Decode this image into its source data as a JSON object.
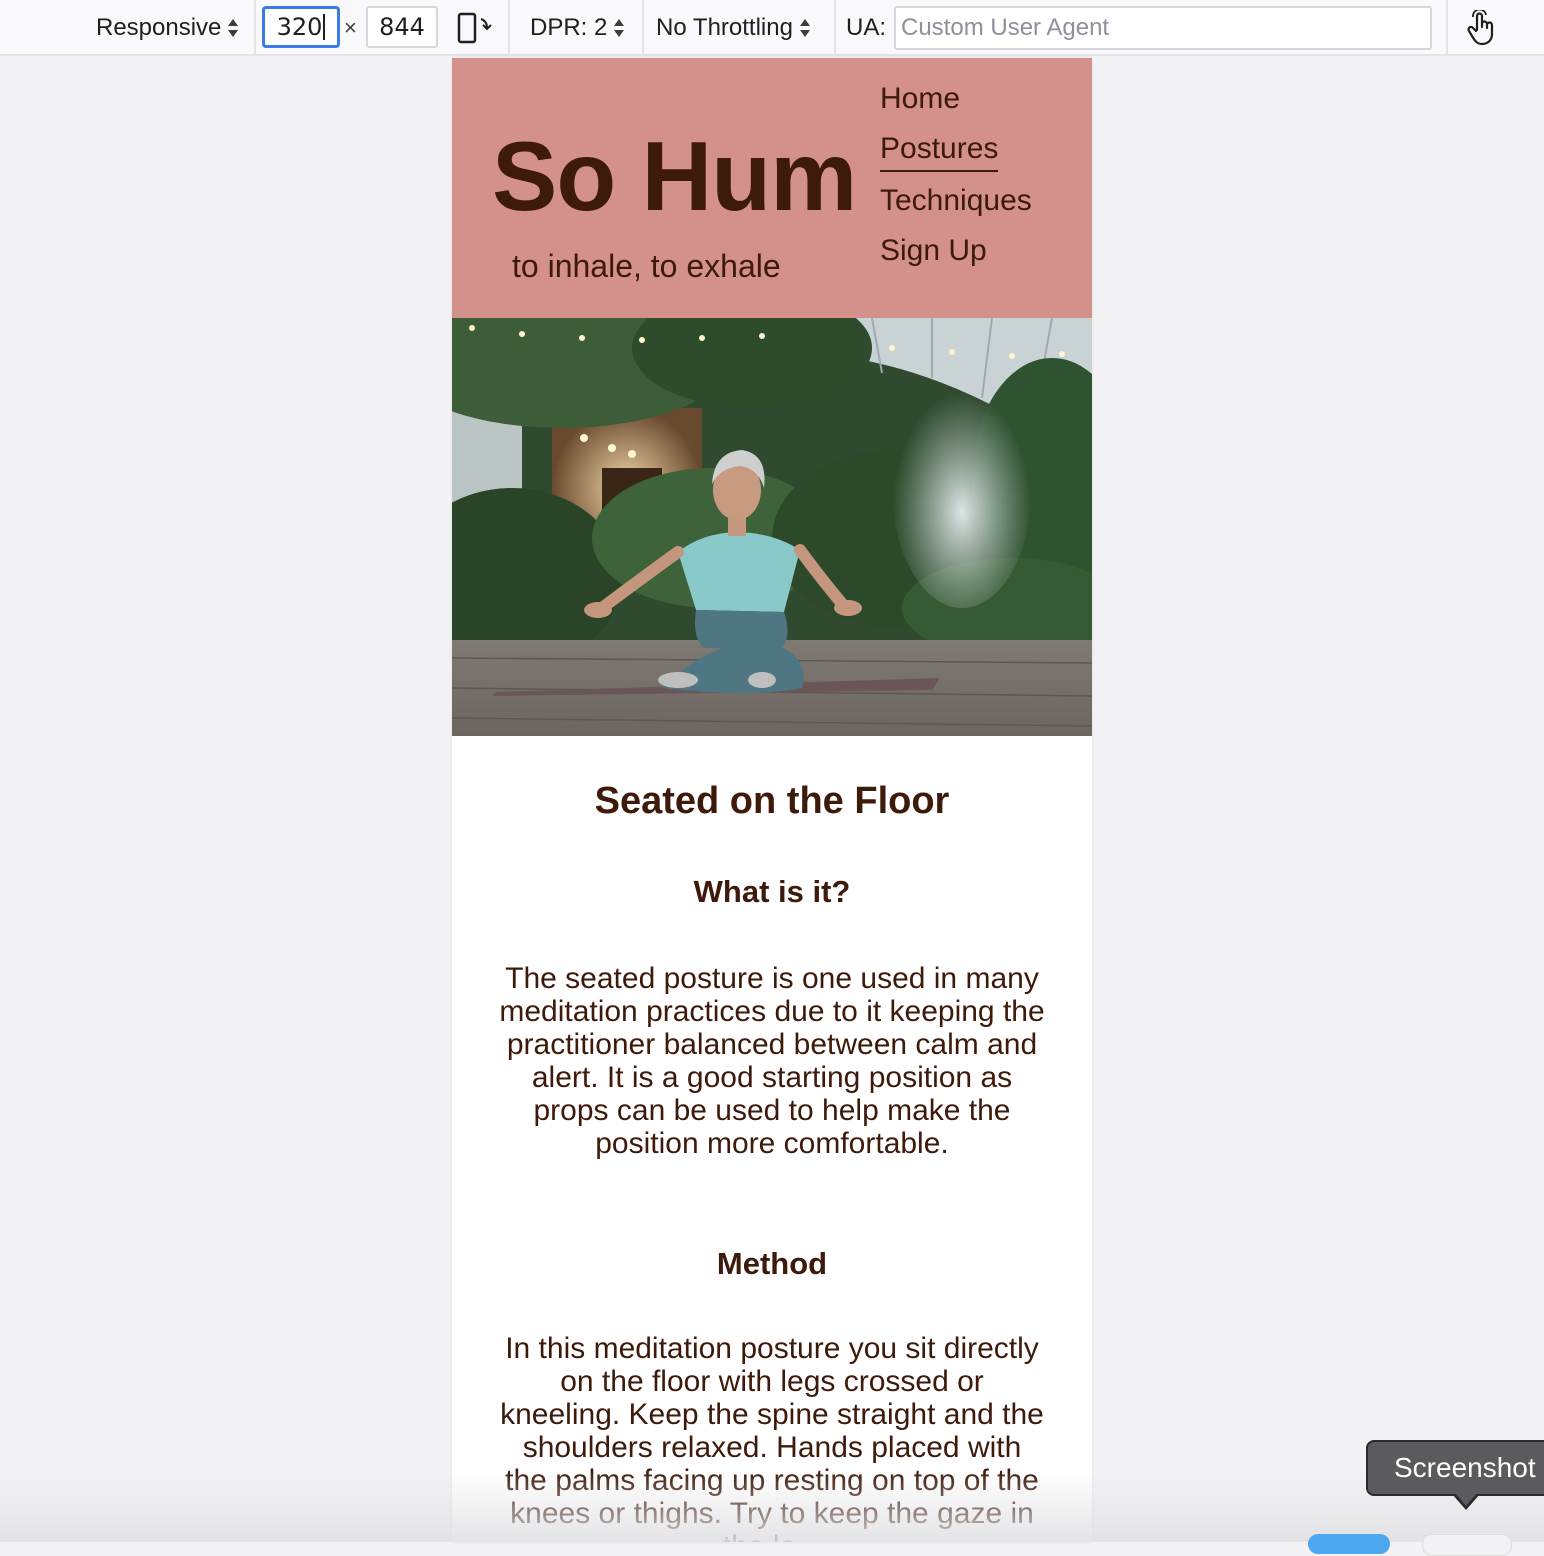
{
  "toolbar": {
    "device_label": "Responsive",
    "width_value": "320",
    "times_symbol": "×",
    "height_value": "844",
    "dpr_label": "DPR: 2",
    "throttling_label": "No Throttling",
    "ua_label": "UA:",
    "ua_placeholder": "Custom User Agent",
    "icons": [
      "rotate-device-icon",
      "touch-simulation-icon"
    ]
  },
  "site": {
    "logo": "So Hum",
    "tagline": "to inhale, to exhale",
    "nav": [
      {
        "label": "Home"
      },
      {
        "label": "Postures"
      },
      {
        "label": "Techniques"
      },
      {
        "label": "Sign Up"
      }
    ],
    "active_nav": "Postures"
  },
  "content": {
    "title": "Seated on the Floor",
    "section1_heading": "What is it?",
    "section1_text": "The seated posture is one used in many meditation practices due to it keeping the practitioner balanced between calm and alert. It is a good starting position as props can be used to help make the position more comfortable.",
    "section2_heading": "Method",
    "section2_text": "In this meditation posture you sit directly on the floor with legs crossed or kneeling. Keep the spine straight and the shoulders relaxed. Hands placed with the palms facing up resting on top of the knees or thighs. Try to keep the gaze in the lo..."
  },
  "tooltip": {
    "label": "Screenshot"
  },
  "colors": {
    "header_bg": "#d4918b",
    "text_brown": "#3d1a0a",
    "focus_blue": "#3b7be8"
  }
}
